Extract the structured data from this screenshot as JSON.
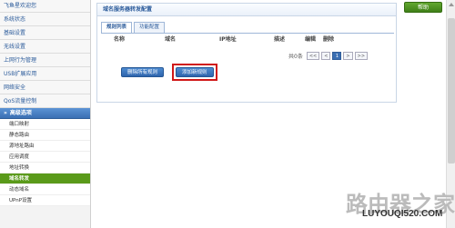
{
  "sidebar": {
    "welcome": "飞鱼星欢迎您",
    "items": [
      "系统状态",
      "基础设置",
      "无线设置",
      "上网行为管理",
      "USB扩展应用",
      "网络安全",
      "QoS流量控制"
    ],
    "group_label": "高级选项",
    "subitems": [
      "端口映射",
      "静态路由",
      "源地址路由",
      "应用调度",
      "地址转换",
      "域名转发",
      "动态域名",
      "UPnP设置"
    ],
    "active_subitem": "域名转发"
  },
  "header": {
    "help_label": "帮助"
  },
  "main": {
    "title": "域名服务器转发配置",
    "tabs": [
      {
        "label": "规则列表",
        "active": true
      },
      {
        "label": "功能配置",
        "active": false
      }
    ],
    "table": {
      "columns": [
        "名称",
        "域名",
        "IP地址",
        "描述",
        "编辑",
        "删除"
      ],
      "rows": []
    },
    "pager": {
      "total_text": "共0条",
      "first": "<<",
      "prev": "<",
      "current": "1",
      "next": ">",
      "last": ">>"
    },
    "buttons": {
      "delete_all": "删除所有规则",
      "add_rule": "添加新规则"
    }
  },
  "watermark": {
    "logo_text": "路由器之家",
    "url": "LUYOUQI520.COM"
  },
  "colors": {
    "accent_blue": "#3a6fb3",
    "active_green": "#5a9a1a",
    "highlight_red": "#d01818"
  }
}
